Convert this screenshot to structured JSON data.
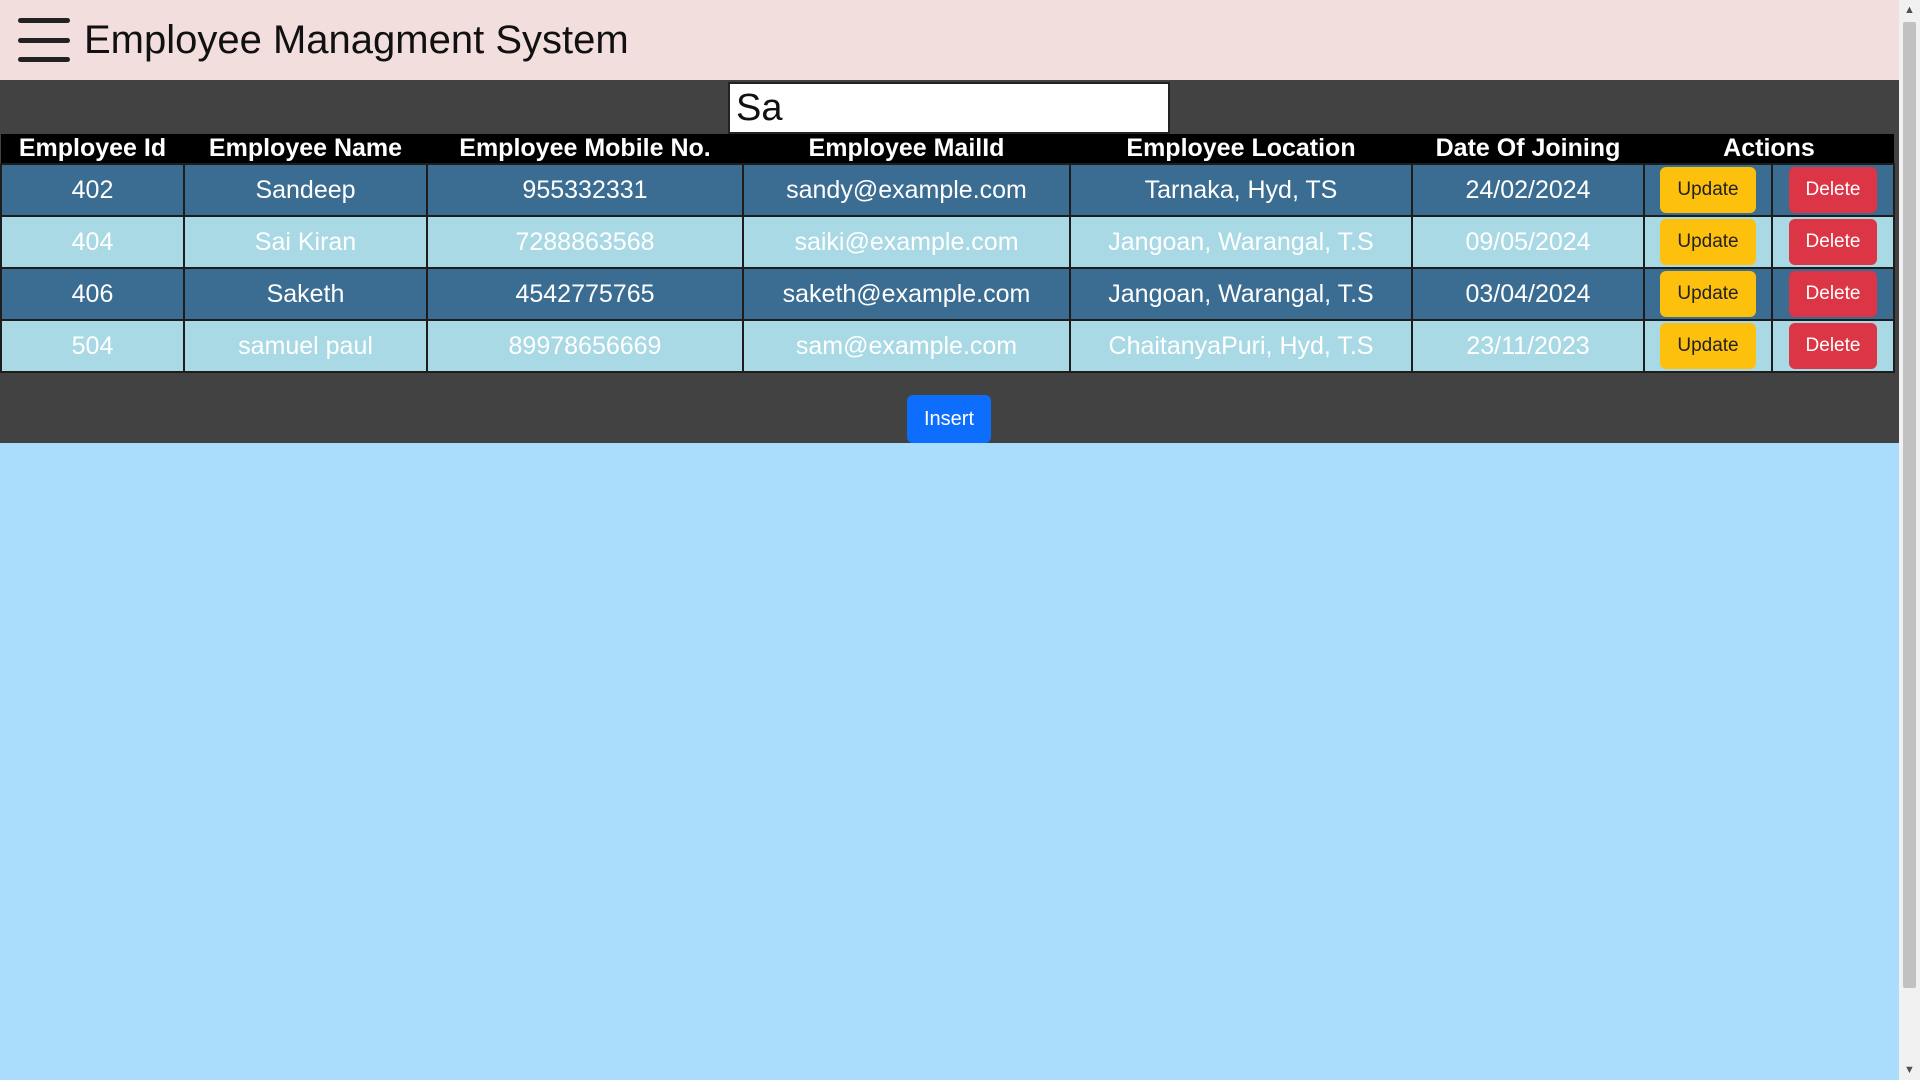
{
  "app": {
    "title": "Employee Managment System"
  },
  "search": {
    "value": "Sa"
  },
  "table": {
    "headers": [
      "Employee Id",
      "Employee Name",
      "Employee Mobile No.",
      "Employee MailId",
      "Employee Location",
      "Date Of Joining",
      "Actions"
    ],
    "rows": [
      {
        "id": "402",
        "name": "Sandeep",
        "mobile": "955332331",
        "email": "sandy@example.com",
        "location": "Tarnaka, Hyd, TS",
        "doj": "24/02/2024"
      },
      {
        "id": "404",
        "name": "Sai Kiran",
        "mobile": "7288863568",
        "email": "saiki@example.com",
        "location": "Jangoan, Warangal, T.S",
        "doj": "09/05/2024"
      },
      {
        "id": "406",
        "name": "Saketh",
        "mobile": "4542775765",
        "email": "saketh@example.com",
        "location": "Jangoan, Warangal, T.S",
        "doj": "03/04/2024"
      },
      {
        "id": "504",
        "name": "samuel paul",
        "mobile": "89978656669",
        "email": "sam@example.com",
        "location": "ChaitanyaPuri, Hyd, T.S",
        "doj": "23/11/2023"
      }
    ],
    "update_label": "Update",
    "delete_label": "Delete"
  },
  "insert_label": "Insert",
  "colors": {
    "header_bg": "#f3dede",
    "page_bg": "#a9ddfb",
    "panel_bg": "#424242",
    "row_dark": "#3b6c91",
    "row_light": "#a8d9e5",
    "update": "#fcc00d",
    "delete": "#dc3545",
    "insert": "#0d6efd"
  },
  "icons": {
    "menu": "hamburger-menu-icon"
  }
}
